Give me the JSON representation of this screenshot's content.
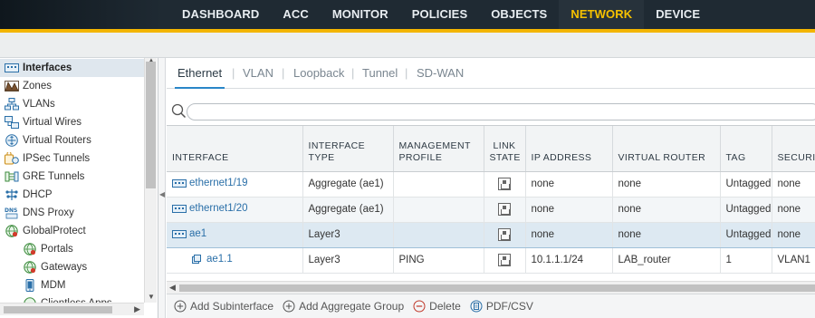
{
  "top_nav": {
    "tabs": [
      "DASHBOARD",
      "ACC",
      "MONITOR",
      "POLICIES",
      "OBJECTS",
      "NETWORK",
      "DEVICE"
    ],
    "active": "NETWORK",
    "active_color": "#f6c100",
    "accent_color": "#f3b500"
  },
  "sidebar": {
    "items": [
      {
        "label": "Interfaces",
        "icon": "interfaces-icon",
        "selected": true
      },
      {
        "label": "Zones",
        "icon": "zones-icon"
      },
      {
        "label": "VLANs",
        "icon": "vlans-icon"
      },
      {
        "label": "Virtual Wires",
        "icon": "virtual-wires-icon"
      },
      {
        "label": "Virtual Routers",
        "icon": "virtual-routers-icon"
      },
      {
        "label": "IPSec Tunnels",
        "icon": "ipsec-tunnels-icon"
      },
      {
        "label": "GRE Tunnels",
        "icon": "gre-tunnels-icon"
      },
      {
        "label": "DHCP",
        "icon": "dhcp-icon"
      },
      {
        "label": "DNS Proxy",
        "icon": "dns-proxy-icon"
      },
      {
        "label": "GlobalProtect",
        "icon": "globalprotect-icon"
      },
      {
        "label": "Portals",
        "icon": "portals-icon",
        "child": true
      },
      {
        "label": "Gateways",
        "icon": "gateways-icon",
        "child": true
      },
      {
        "label": "MDM",
        "icon": "mdm-icon",
        "child": true
      },
      {
        "label": "Clientless Apps",
        "icon": "clientless-apps-icon",
        "child": true
      }
    ]
  },
  "subtabs": {
    "items": [
      "Ethernet",
      "VLAN",
      "Loopback",
      "Tunnel",
      "SD-WAN"
    ],
    "active": "Ethernet"
  },
  "search": {
    "value": "",
    "placeholder": ""
  },
  "table": {
    "columns": {
      "interface": "INTERFACE",
      "interface_type": "INTERFACE TYPE",
      "management_profile": "MANAGEMENT PROFILE",
      "link_state": "LINK STATE",
      "ip_address": "IP ADDRESS",
      "virtual_router": "VIRTUAL ROUTER",
      "tag": "TAG",
      "security_zone": "SECURI"
    },
    "rows": [
      {
        "interface": "ethernet1/19",
        "interface_type": "Aggregate (ae1)",
        "management_profile": "",
        "ip_address": "none",
        "virtual_router": "none",
        "tag": "Untagged",
        "security_zone": "none"
      },
      {
        "interface": "ethernet1/20",
        "interface_type": "Aggregate (ae1)",
        "management_profile": "",
        "ip_address": "none",
        "virtual_router": "none",
        "tag": "Untagged",
        "security_zone": "none"
      },
      {
        "interface": "ae1",
        "interface_type": "Layer3",
        "management_profile": "",
        "ip_address": "none",
        "virtual_router": "none",
        "tag": "Untagged",
        "security_zone": "none"
      },
      {
        "interface": "ae1.1",
        "interface_type": "Layer3",
        "management_profile": "PING",
        "ip_address": "10.1.1.1/24",
        "virtual_router": "LAB_router",
        "tag": "1",
        "security_zone": "VLAN1"
      }
    ]
  },
  "actions": {
    "add_subinterface": "Add Subinterface",
    "add_aggregate_group": "Add Aggregate Group",
    "delete": "Delete",
    "pdf_csv": "PDF/CSV"
  }
}
